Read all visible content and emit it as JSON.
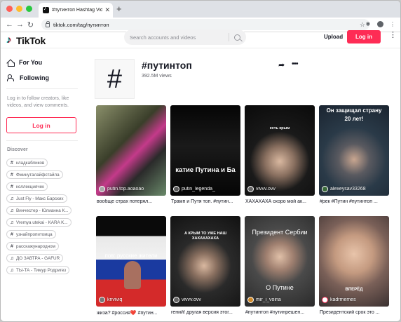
{
  "browser": {
    "tab_title": "#путинтоп Hashtag Videos on",
    "tab_close": "✕",
    "new_tab": "+",
    "url": "tiktok.com/tag/путинтоп"
  },
  "header": {
    "logo_text": "TikTok",
    "search_placeholder": "Search accounts and videos",
    "upload": "Upload",
    "login": "Log in"
  },
  "sidebar": {
    "nav": [
      {
        "label": "For You",
        "icon": "home-icon"
      },
      {
        "label": "Following",
        "icon": "users-icon"
      }
    ],
    "login_prompt": "Log in to follow creators, like videos, and view comments.",
    "login_button": "Log in",
    "discover_title": "Discover",
    "discover_items": [
      {
        "type": "hashtag",
        "label": "кладкабликов"
      },
      {
        "type": "hashtag",
        "label": "Фминуталайфстайла"
      },
      {
        "type": "hashtag",
        "label": "коллекциячек"
      },
      {
        "type": "music",
        "label": "Just Fly - Макс Барских"
      },
      {
        "type": "music",
        "label": "Винчестер - Юлианна К..."
      },
      {
        "type": "music",
        "label": "Vremya utekai - KARA K..."
      },
      {
        "type": "hashtag",
        "label": "узнайпропитомца"
      },
      {
        "type": "hashtag",
        "label": "расскажународном"
      },
      {
        "type": "music",
        "label": "ДО ЗАВТРА - GAFUR"
      },
      {
        "type": "music",
        "label": "ТЫ-ТА - Тимур Родригез"
      }
    ]
  },
  "tag": {
    "icon": "#",
    "title": "#путинтоп",
    "views": "392.5M views"
  },
  "videos": [
    {
      "user": "putin.top.aoaoao",
      "caption": "вообще страх потерял...",
      "overlay": "",
      "bg": "#4a5030"
    },
    {
      "user": "putin_legenda_",
      "caption": "Трамп и Путя топ. #путин...",
      "overlay": "катие Путина и Ба",
      "bg": "#0a0a0a"
    },
    {
      "user": "vivvv.ovv",
      "caption": "ХАХАХАХА скоро мой ак...",
      "overlay": "есть крым",
      "bg": "#1a1a1a"
    },
    {
      "user": "alexeysav33268",
      "caption": "#рек #Путин #путинтоп ...",
      "overlay": "Он защищал страну 20 лет!",
      "bg": "#1c2a38"
    },
    {
      "user": "knviviq",
      "caption": "жиза? #россия❤️ #путин...",
      "overlay": "пов: русские жители",
      "bg": "#d8d8d8"
    },
    {
      "user": "vivvv.ovv",
      "caption": "гений! другая версия этог...",
      "overlay": "А КРЫМ ТО УЖЕ НАШ ХАХАХАХАХА",
      "bg": "#1a1a1a"
    },
    {
      "user": "mir_i_voina",
      "caption": "#путинтоп #путинрешен...",
      "overlay": "Президент Сербии",
      "overlay2": "О Путине",
      "bg": "#3a3a3a"
    },
    {
      "user": "kadrmemes",
      "caption": "Президентский срок это ...",
      "overlay": "ВПЕРЁД",
      "bg": "#9a7a6a"
    }
  ]
}
